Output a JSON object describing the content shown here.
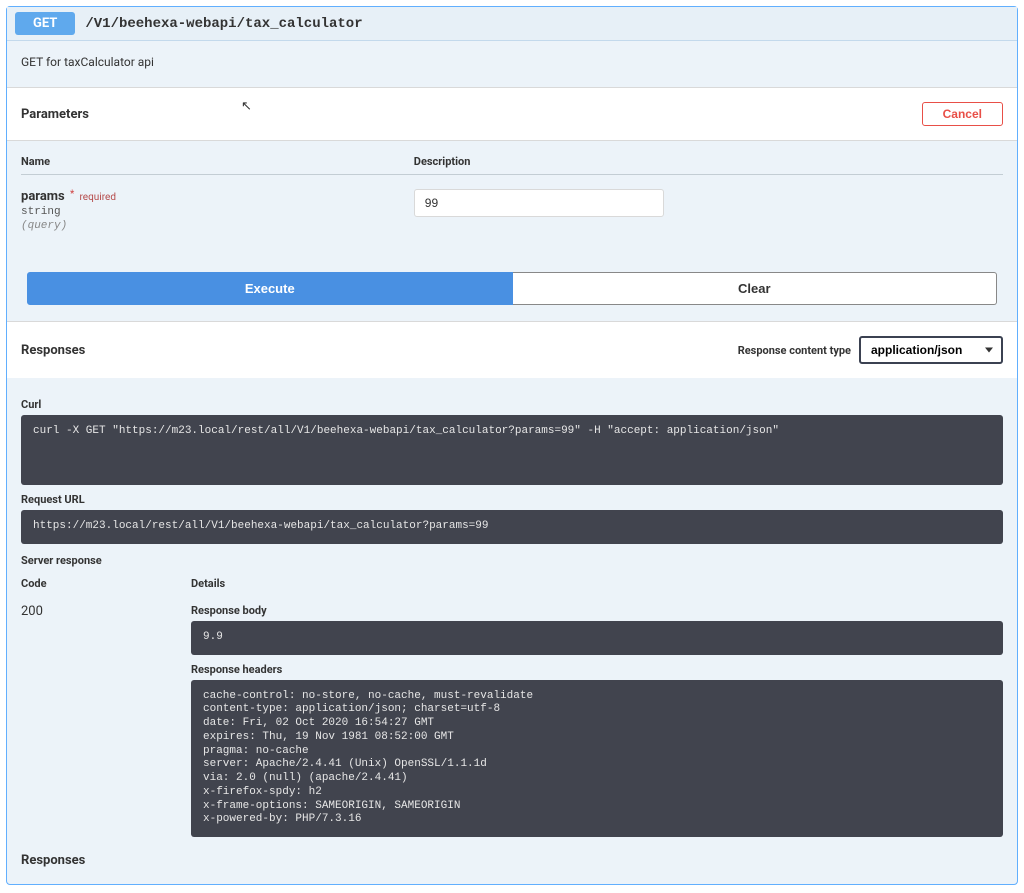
{
  "op": {
    "method": "GET",
    "path": "/V1/beehexa-webapi/tax_calculator",
    "description": "GET for taxCalculator api"
  },
  "parameters": {
    "section_title": "Parameters",
    "cancel_label": "Cancel",
    "columns": {
      "name": "Name",
      "description": "Description"
    },
    "items": [
      {
        "name": "params",
        "required_star": "*",
        "required_label": "required",
        "type": "string",
        "in": "(query)",
        "value": "99"
      }
    ]
  },
  "buttons": {
    "execute": "Execute",
    "clear": "Clear"
  },
  "responses": {
    "section_title": "Responses",
    "content_type_label": "Response content type",
    "content_type_value": "application/json"
  },
  "result": {
    "curl_label": "Curl",
    "curl": "curl -X GET \"https://m23.local/rest/all/V1/beehexa-webapi/tax_calculator?params=99\" -H \"accept: application/json\"",
    "request_url_label": "Request URL",
    "request_url": "https://m23.local/rest/all/V1/beehexa-webapi/tax_calculator?params=99",
    "server_response_label": "Server response",
    "columns": {
      "code": "Code",
      "details": "Details"
    },
    "code": "200",
    "response_body_label": "Response body",
    "response_body": "9.9",
    "response_headers_label": "Response headers",
    "response_headers": "cache-control: no-store, no-cache, must-revalidate\ncontent-type: application/json; charset=utf-8\ndate: Fri, 02 Oct 2020 16:54:27 GMT\nexpires: Thu, 19 Nov 1981 08:52:00 GMT\npragma: no-cache\nserver: Apache/2.4.41 (Unix) OpenSSL/1.1.1d\nvia: 2.0 (null) (apache/2.4.41)\nx-firefox-spdy: h2\nx-frame-options: SAMEORIGIN, SAMEORIGIN\nx-powered-by: PHP/7.3.16"
  },
  "footer": {
    "responses_title": "Responses"
  }
}
